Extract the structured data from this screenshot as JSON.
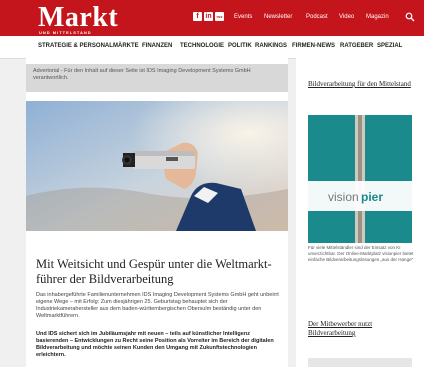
{
  "brand": {
    "name": "Markt",
    "tagline": "UND MITTELSTAND"
  },
  "social": [
    "f",
    "in",
    "rss"
  ],
  "topnav": [
    "Events",
    "Newsletter",
    "Podcast",
    "Video",
    "Magazin"
  ],
  "mainnav": [
    "STRATEGIE & PERSONAL",
    "MÄRKTE",
    "FINANZEN",
    "TECHNOLOGIE",
    "POLITIK",
    "RANKINGS",
    "FIRMEN-NEWS",
    "RATGEBER",
    "SPEZIAL"
  ],
  "advert": "Advertorial - Für den Inhalt auf dieser Seite ist IDS Imaging Development Systems GmbH verantwortlich.",
  "article": {
    "title": "Mit Weitsicht und Gespür unter die Weltmarkt-führer der Bildverarbeitung",
    "intro": "Das inhabergeführte Familienunternehmen IDS Imaging Development Systems GmbH geht unbeirrt eigene Wege – mit Erfolg: Zum diesjährigen 25. Geburtstag behauptet sich der Industriekamerahersteller aus dem baden-württembergischen Obersulm beständig unter den Weltmarktführern.",
    "lead": "Und IDS sichert sich im Jubiläumsjahr mit neuen – teils auf künstlicher Intelligenz basierenden – Entwicklungen zu Recht seine Position als Vorreiter im Bereich der digitalen Bildverarbeitung und möchte seinen Kunden den Umgang mit Zukunftstechnologien erleichtern."
  },
  "sidebar": {
    "title1": "Bildverarbeitung für den Mittelstand",
    "ad_brand_a": "vision",
    "ad_brand_b": "pier",
    "ad_text": "Für viele Mittelständler sind der Einsatz von KI unverzichtbar. Der Online-Marktplatz visionpier bietet einfache Bildverarbeitungslösungen „aus der Hange\"",
    "title2": "Der Mitbewerber nutzt Bildverarbeitung"
  },
  "colors": {
    "brand_red": "#c4151c",
    "ad_teal": "#1a8a8c"
  }
}
